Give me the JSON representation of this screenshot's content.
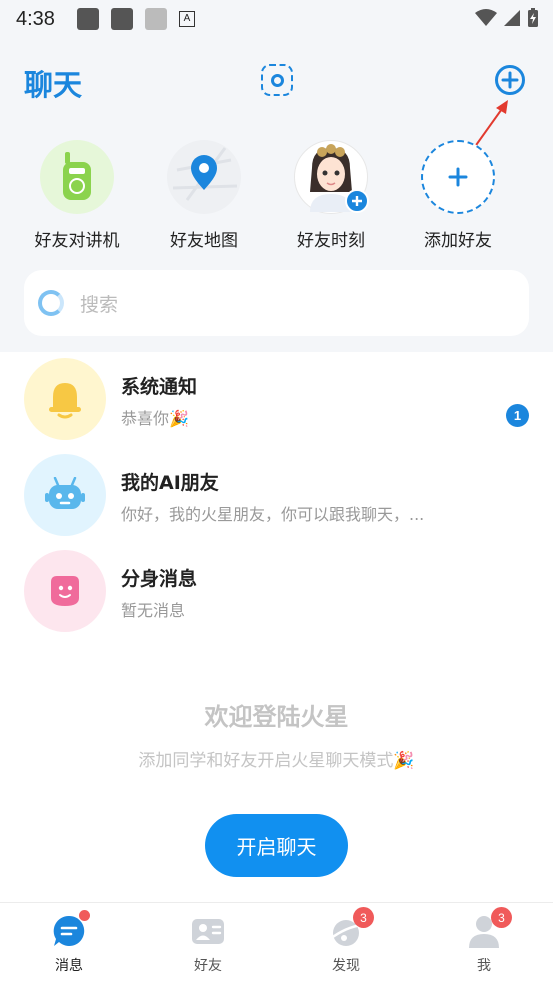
{
  "status_bar": {
    "time": "4:38",
    "a_icon": "A"
  },
  "header": {
    "title": "聊天"
  },
  "quick_actions": [
    {
      "label": "好友对讲机",
      "icon": "walkie-talkie-icon"
    },
    {
      "label": "好友地图",
      "icon": "map-pin-icon"
    },
    {
      "label": "好友时刻",
      "icon": "avatar-moment-icon"
    },
    {
      "label": "添加好友",
      "icon": "add-friend-icon"
    }
  ],
  "search": {
    "placeholder": "搜索"
  },
  "conversations": [
    {
      "title": "系统通知",
      "subtitle": "恭喜你🎉",
      "badge": "1",
      "color": "#fff6cf"
    },
    {
      "title": "我的AI朋友",
      "subtitle": "你好，我的火星朋友，你可以跟我聊天，...",
      "color": "#e1f4fe"
    },
    {
      "title": "分身消息",
      "subtitle": "暂无消息",
      "color": "#fde6ee"
    }
  ],
  "welcome": {
    "title": "欢迎登陆火星",
    "subtitle": "添加同学和好友开启火星聊天模式🎉",
    "button": "开启聊天"
  },
  "tabs": [
    {
      "label": "消息",
      "active": true
    },
    {
      "label": "好友"
    },
    {
      "label": "发现",
      "badge": "3"
    },
    {
      "label": "我",
      "badge": "3"
    }
  ],
  "colors": {
    "accent": "#1b86dd",
    "button": "#1190f0",
    "badge_red": "#f05a5a"
  }
}
